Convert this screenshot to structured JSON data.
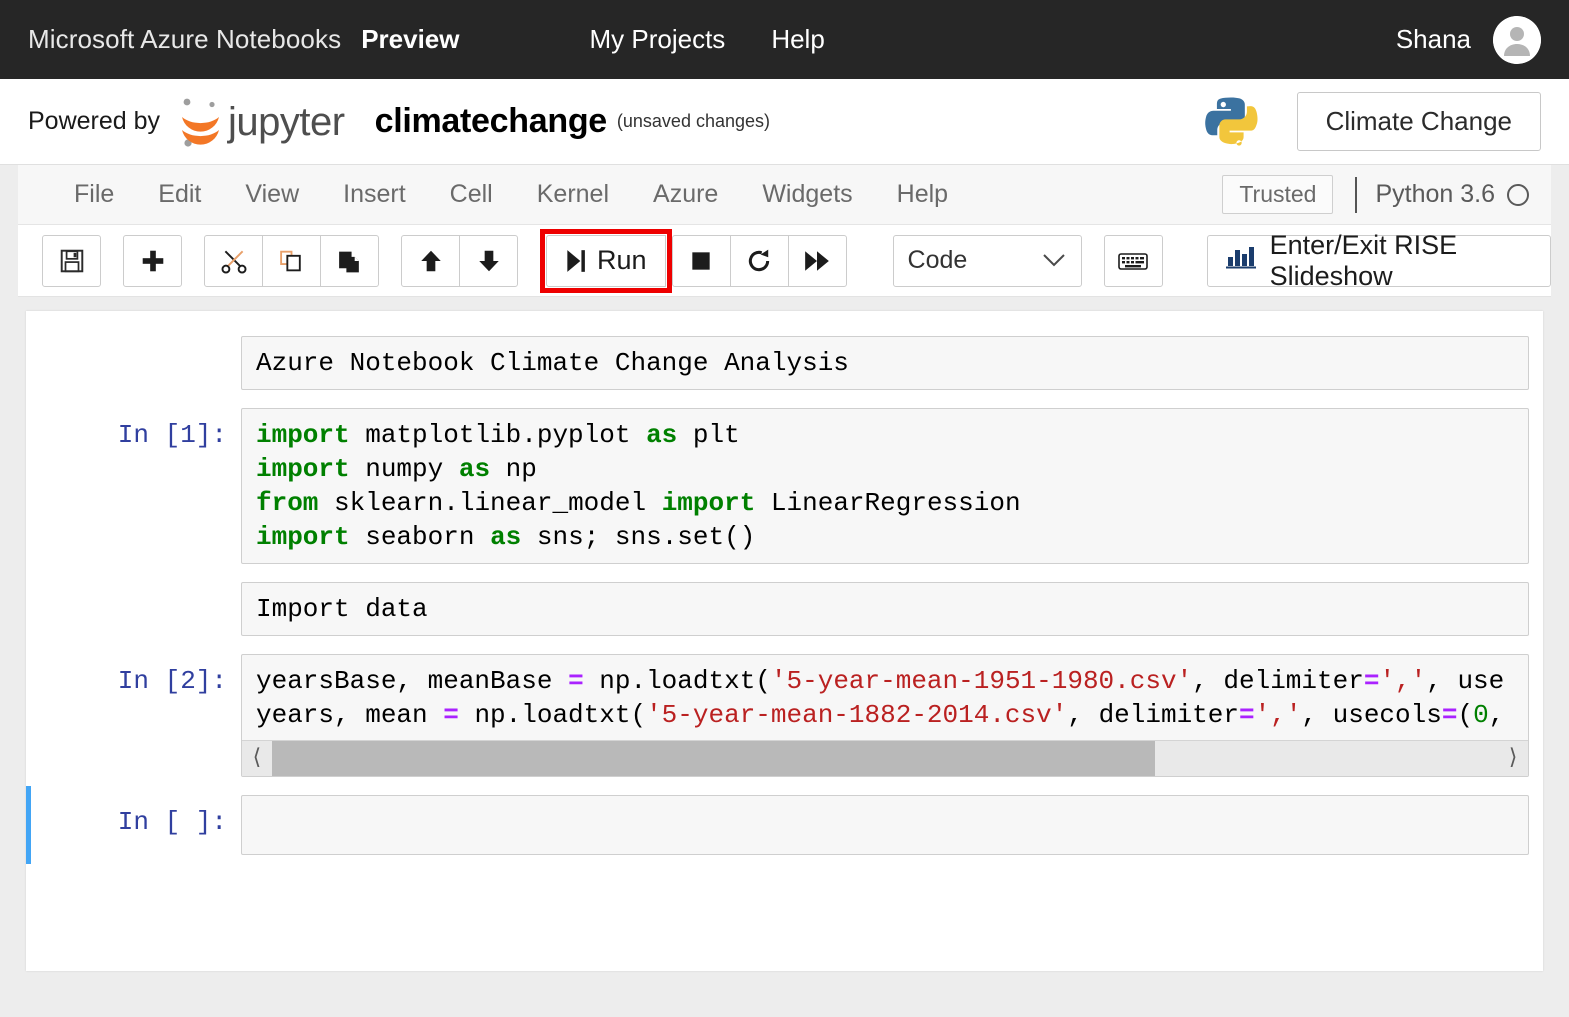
{
  "azure_bar": {
    "brand": "Microsoft Azure Notebooks",
    "preview": "Preview",
    "nav": [
      {
        "label": "My Projects"
      },
      {
        "label": "Help"
      }
    ],
    "user": "Shana",
    "avatar_icon": "user-avatar-icon"
  },
  "jupyter_header": {
    "powered_by": "Powered by",
    "logo_word": "jupyter",
    "notebook_name": "climatechange",
    "save_status": "(unsaved changes)",
    "kernel_logo_icon": "python-logo-icon",
    "project_button": "Climate Change"
  },
  "menubar": {
    "items": [
      {
        "label": "File"
      },
      {
        "label": "Edit"
      },
      {
        "label": "View"
      },
      {
        "label": "Insert"
      },
      {
        "label": "Cell"
      },
      {
        "label": "Kernel"
      },
      {
        "label": "Azure"
      },
      {
        "label": "Widgets"
      },
      {
        "label": "Help"
      }
    ],
    "trusted": "Trusted",
    "kernel_name": "Python 3.6",
    "kernel_status_icon": "kernel-idle-circle-icon"
  },
  "toolbar": {
    "save_icon": "save-floppy-icon",
    "insert_icon": "add-plus-icon",
    "cut_icon": "scissors-icon",
    "copy_icon": "copy-icon",
    "paste_icon": "paste-icon",
    "move_up_icon": "arrow-up-icon",
    "move_down_icon": "arrow-down-icon",
    "run_label": "Run",
    "run_icon": "run-play-bar-icon",
    "interrupt_icon": "stop-square-icon",
    "restart_icon": "restart-circular-arrow-icon",
    "restart_run_all_icon": "fast-forward-icon",
    "cell_type_value": "Code",
    "cell_type_chevron_icon": "chevron-down-icon",
    "keyboard_icon": "keyboard-icon",
    "rise_icon": "bar-chart-icon",
    "rise_label": "Enter/Exit RISE Slideshow",
    "highlight_color": "#ee0000"
  },
  "notebook": {
    "cells": [
      {
        "type": "markdown",
        "prompt": "",
        "text": "Azure Notebook Climate Change Analysis"
      },
      {
        "type": "code",
        "prompt": "In [1]:",
        "lines": [
          [
            {
              "t": "import",
              "c": "kw"
            },
            {
              "t": " matplotlib.pyplot ",
              "c": ""
            },
            {
              "t": "as",
              "c": "kw"
            },
            {
              "t": " plt",
              "c": ""
            }
          ],
          [
            {
              "t": "import",
              "c": "kw"
            },
            {
              "t": " numpy ",
              "c": ""
            },
            {
              "t": "as",
              "c": "kw"
            },
            {
              "t": " np",
              "c": ""
            }
          ],
          [
            {
              "t": "from",
              "c": "kw"
            },
            {
              "t": " sklearn.linear_model ",
              "c": ""
            },
            {
              "t": "import",
              "c": "kw"
            },
            {
              "t": " LinearRegression",
              "c": ""
            }
          ],
          [
            {
              "t": "import",
              "c": "kw"
            },
            {
              "t": " seaborn ",
              "c": ""
            },
            {
              "t": "as",
              "c": "kw"
            },
            {
              "t": " sns; sns.set()",
              "c": ""
            }
          ]
        ]
      },
      {
        "type": "markdown",
        "prompt": "",
        "text": "Import data"
      },
      {
        "type": "code",
        "prompt": "In [2]:",
        "scrollbar": true,
        "lines": [
          [
            {
              "t": "yearsBase, meanBase ",
              "c": ""
            },
            {
              "t": "=",
              "c": "op"
            },
            {
              "t": " np.loadtxt(",
              "c": ""
            },
            {
              "t": "'5-year-mean-1951-1980.csv'",
              "c": "str"
            },
            {
              "t": ", delimiter",
              "c": ""
            },
            {
              "t": "=",
              "c": "op"
            },
            {
              "t": "','",
              "c": "str"
            },
            {
              "t": ", use",
              "c": ""
            }
          ],
          [
            {
              "t": "years, mean ",
              "c": ""
            },
            {
              "t": "=",
              "c": "op"
            },
            {
              "t": " np.loadtxt(",
              "c": ""
            },
            {
              "t": "'5-year-mean-1882-2014.csv'",
              "c": "str"
            },
            {
              "t": ", delimiter",
              "c": ""
            },
            {
              "t": "=",
              "c": "op"
            },
            {
              "t": "','",
              "c": "str"
            },
            {
              "t": ", usecols",
              "c": ""
            },
            {
              "t": "=",
              "c": "op"
            },
            {
              "t": "(",
              "c": ""
            },
            {
              "t": "0",
              "c": "num"
            },
            {
              "t": ",",
              "c": ""
            }
          ]
        ]
      },
      {
        "type": "code",
        "prompt": "In [ ]:",
        "selected": true,
        "empty": true,
        "lines": []
      }
    ],
    "scrollbar": {
      "left_arrow_icon": "chevron-left-icon",
      "right_arrow_icon": "chevron-right-icon",
      "thumb_width_pct": 72
    }
  }
}
